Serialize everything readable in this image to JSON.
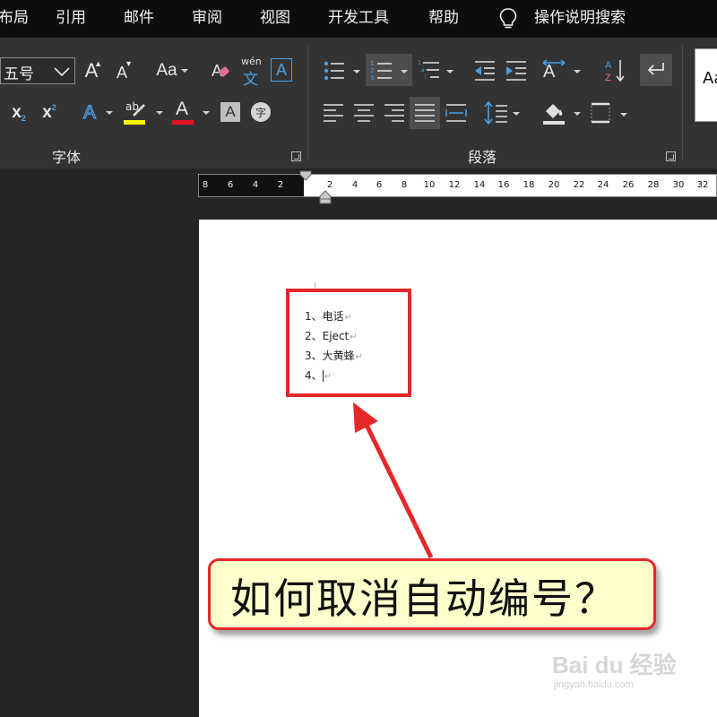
{
  "menu": {
    "items": [
      "布局",
      "引用",
      "邮件",
      "审阅",
      "视图",
      "开发工具",
      "帮助"
    ],
    "tell_me": "操作说明搜索",
    "tell_me_icon": "lightbulb-icon"
  },
  "ribbon": {
    "font_group": {
      "label": "字体",
      "font_size": "五号",
      "change_case": "Aa",
      "phonetic_top": "wén",
      "phonetic_bottom": "文",
      "char_border": "A",
      "grow_font": "A",
      "shrink_font": "A",
      "subscript": "x",
      "subscript_mark": "2",
      "superscript": "x",
      "superscript_mark": "2",
      "text_effect": "A",
      "highlight": "ab",
      "font_color": "A",
      "char_shading": "A",
      "enclose": "字",
      "highlight_color": "#ffff00",
      "font_color_bar": "#e81123"
    },
    "paragraph_group": {
      "label": "段落"
    },
    "styles": {
      "preview": "Aa"
    }
  },
  "ruler": {
    "left_ticks": [
      "8",
      "6",
      "4",
      "2"
    ],
    "right_ticks": [
      "2",
      "4",
      "6",
      "8",
      "10",
      "12",
      "14",
      "16",
      "18",
      "20",
      "22",
      "24",
      "26",
      "28",
      "30",
      "32"
    ]
  },
  "document": {
    "list": [
      {
        "num": "1、",
        "text": "电话"
      },
      {
        "num": "2、",
        "text": "Eject"
      },
      {
        "num": "3、",
        "text": "大黄蜂"
      },
      {
        "num": "4、",
        "text": ""
      }
    ],
    "paragraph_mark": "↵"
  },
  "annotation": {
    "callout_text": "如何取消自动编号？",
    "highlight_color": "#e5272a",
    "callout_bg": "#ffffcc"
  },
  "watermark": {
    "main": "Bai du 经验",
    "sub": "jingyan.baidu.com"
  }
}
